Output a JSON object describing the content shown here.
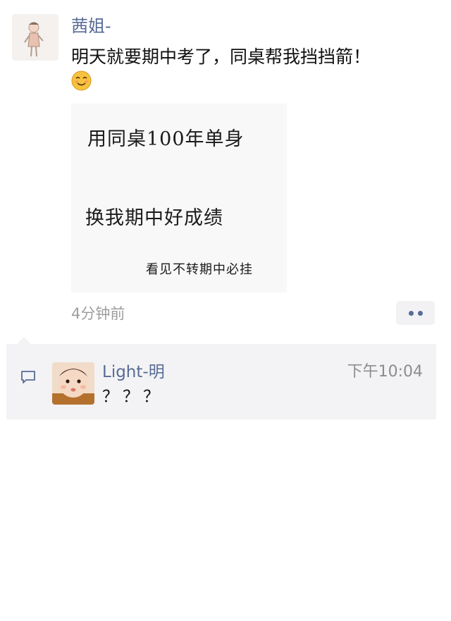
{
  "post": {
    "author_name": "茜姐-",
    "text": "明天就要期中考了，同桌帮我挡挡箭！",
    "emoji": "smiling-face-emoji",
    "image_lines": [
      "用同桌100年单身",
      "换我期中好成绩",
      "看见不转期中必挂"
    ],
    "timestamp": "4分钟前",
    "more_icon": "more-dots-icon"
  },
  "comments": [
    {
      "name": "Light-明",
      "time": "下午10:04",
      "text": "？？？",
      "icon": "comment-icon"
    }
  ],
  "colors": {
    "link_blue": "#576b95",
    "comment_bg": "#f3f3f5",
    "timestamp_gray": "#9e9e9e"
  }
}
